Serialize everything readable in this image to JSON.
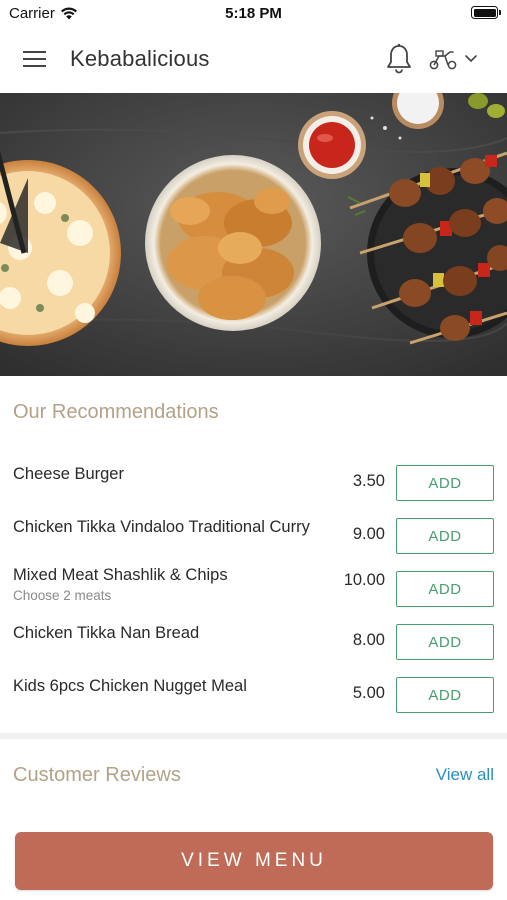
{
  "status_bar": {
    "carrier": "Carrier",
    "time": "5:18 PM",
    "wifi_icon": "wifi-icon",
    "battery_icon": "battery-icon"
  },
  "header": {
    "title": "Kebabalicious",
    "menu_icon": "hamburger-menu-icon",
    "bell_icon": "bell-icon",
    "delivery_icon": "scooter-icon",
    "dropdown_icon": "chevron-down-icon"
  },
  "recommendations": {
    "title": "Our Recommendations",
    "add_label": "ADD",
    "items": [
      {
        "name": "Cheese Burger",
        "subtitle": "",
        "price": "3.50"
      },
      {
        "name": "Chicken Tikka Vindaloo Traditional Curry",
        "subtitle": "",
        "price": "9.00"
      },
      {
        "name": "Mixed Meat Shashlik & Chips",
        "subtitle": "Choose 2 meats",
        "price": "10.00"
      },
      {
        "name": "Chicken Tikka Nan Bread",
        "subtitle": "",
        "price": "8.00"
      },
      {
        "name": "Kids 6pcs Chicken Nugget Meal",
        "subtitle": "",
        "price": "5.00"
      }
    ]
  },
  "reviews": {
    "title": "Customer Reviews",
    "view_all": "View all"
  },
  "footer": {
    "view_menu_label": "VIEW MENU"
  },
  "colors": {
    "accent": "#bf6b57",
    "section_title": "#b3a288",
    "add_green": "#4a9d6e",
    "link_blue": "#2a8fc0"
  }
}
